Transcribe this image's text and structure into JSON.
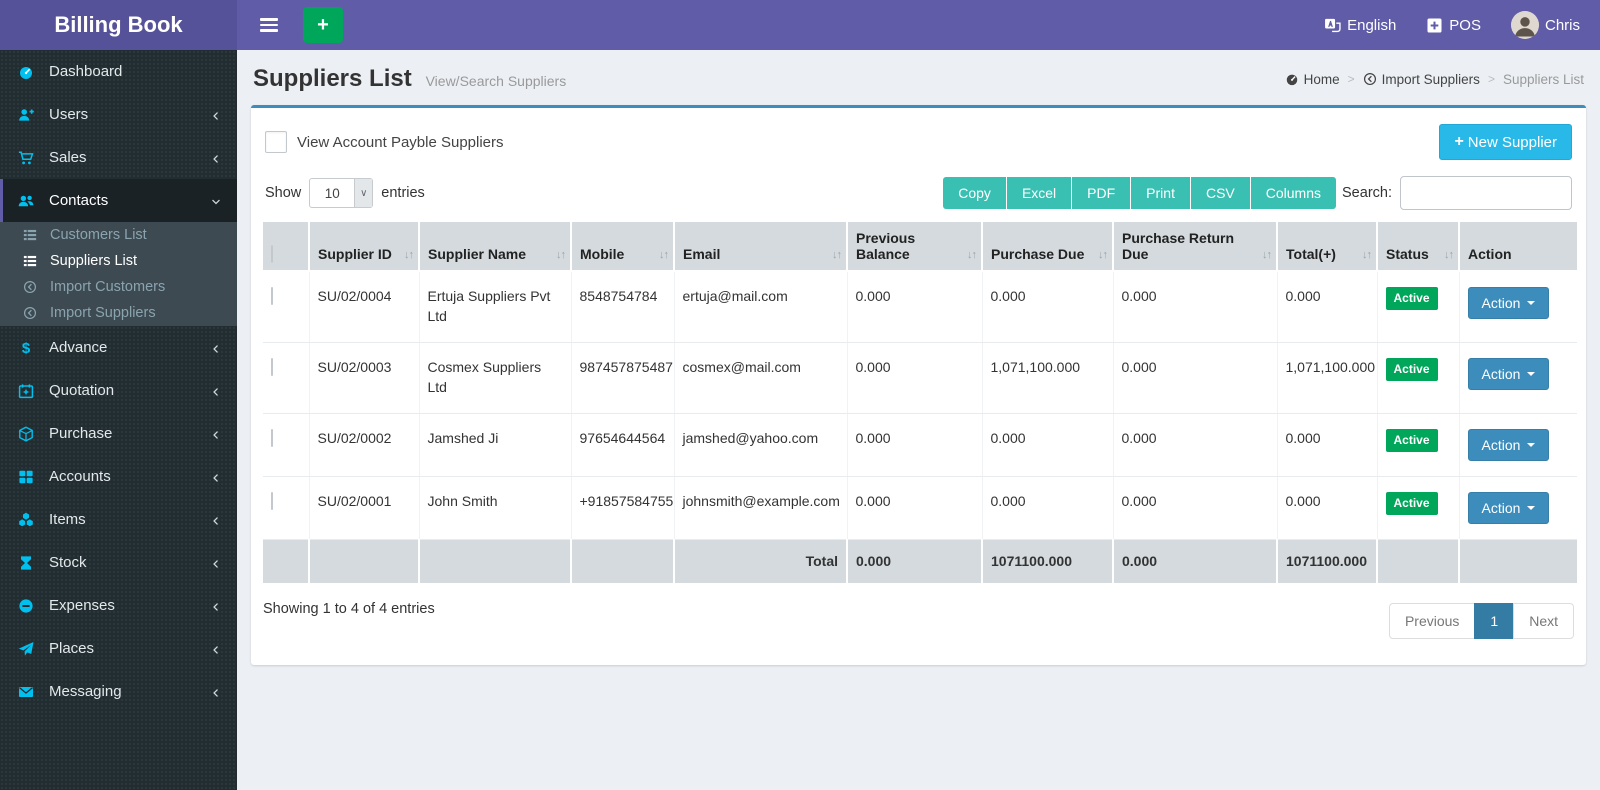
{
  "colors": {
    "navbar": "#605ca8",
    "logo": "#555299",
    "sidebar": "#222d32",
    "submenu": "#3e4a52",
    "sidebar_icon": "#00c0ef",
    "green": "#00a65a",
    "export_teal": "#3ac0b2",
    "new_supplier_blue": "#29b9e8",
    "action_blue": "#3c8dbc",
    "table_header": "#d4dadd",
    "content_bg": "#ecf0f5",
    "badge_green": "#00a65a",
    "pagination_active": "#357ca5"
  },
  "brand": {
    "title": "Billing Book"
  },
  "topbar": {
    "language_label": "English",
    "pos_label": "POS",
    "user_name": "Chris"
  },
  "sidebar": {
    "items": [
      {
        "label": "Dashboard",
        "icon": "tachometer-icon",
        "chevron": null,
        "active": false
      },
      {
        "label": "Users",
        "icon": "user-plus-icon",
        "chevron": "left",
        "active": false
      },
      {
        "label": "Sales",
        "icon": "cart-icon",
        "chevron": "left",
        "active": false
      },
      {
        "label": "Contacts",
        "icon": "users-icon",
        "chevron": "down",
        "active": true,
        "children": [
          {
            "label": "Customers List",
            "icon": "list-icon",
            "active": false
          },
          {
            "label": "Suppliers List",
            "icon": "list-icon",
            "active": true
          },
          {
            "label": "Import Customers",
            "icon": "import-icon",
            "active": false
          },
          {
            "label": "Import Suppliers",
            "icon": "import-icon",
            "active": false
          }
        ]
      },
      {
        "label": "Advance",
        "icon": "dollar-icon",
        "chevron": "left",
        "active": false
      },
      {
        "label": "Quotation",
        "icon": "calendar-plus-icon",
        "chevron": "left",
        "active": false
      },
      {
        "label": "Purchase",
        "icon": "cube-icon",
        "chevron": "left",
        "active": false
      },
      {
        "label": "Accounts",
        "icon": "grid-icon",
        "chevron": "left",
        "active": false
      },
      {
        "label": "Items",
        "icon": "cubes-icon",
        "chevron": "left",
        "active": false
      },
      {
        "label": "Stock",
        "icon": "hourglass-icon",
        "chevron": "left",
        "active": false
      },
      {
        "label": "Expenses",
        "icon": "minus-circle-icon",
        "chevron": "left",
        "active": false
      },
      {
        "label": "Places",
        "icon": "paper-plane-icon",
        "chevron": "left",
        "active": false
      },
      {
        "label": "Messaging",
        "icon": "envelope-icon",
        "chevron": "left",
        "active": false
      }
    ]
  },
  "page": {
    "title": "Suppliers List",
    "subtitle": "View/Search Suppliers",
    "breadcrumb": [
      {
        "label": "Home",
        "icon": "tachometer-icon",
        "current": false
      },
      {
        "label": "Import Suppliers",
        "icon": "import-icon",
        "current": false
      },
      {
        "label": "Suppliers List",
        "icon": null,
        "current": true
      }
    ]
  },
  "card": {
    "filter_label": "View Account Payble Suppliers",
    "filter_checked": false,
    "new_supplier_label": "New Supplier",
    "show_label": "Show",
    "entries_label": "entries",
    "page_length": "10",
    "export_buttons": [
      "Copy",
      "Excel",
      "PDF",
      "Print",
      "CSV",
      "Columns"
    ],
    "search_label": "Search:",
    "search_value": "",
    "table": {
      "columns": [
        {
          "label": "Supplier ID",
          "sortable": true
        },
        {
          "label": "Supplier Name",
          "sortable": true
        },
        {
          "label": "Mobile",
          "sortable": true
        },
        {
          "label": "Email",
          "sortable": true
        },
        {
          "label": "Previous Balance",
          "sortable": true
        },
        {
          "label": "Purchase Due",
          "sortable": true
        },
        {
          "label": "Purchase Return Due",
          "sortable": true
        },
        {
          "label": "Total(+)",
          "sortable": true
        },
        {
          "label": "Status",
          "sortable": true
        },
        {
          "label": "Action",
          "sortable": false
        }
      ],
      "rows": [
        {
          "supplier_id": "SU/02/0004",
          "name": "Ertuja Suppliers Pvt Ltd",
          "mobile": "8548754784",
          "email": "ertuja@mail.com",
          "previous_balance": "0.000",
          "purchase_due": "0.000",
          "purchase_return_due": "0.000",
          "total": "0.000",
          "status": "Active",
          "action_label": "Action"
        },
        {
          "supplier_id": "SU/02/0003",
          "name": "Cosmex Suppliers Ltd",
          "mobile": "987457875487",
          "email": "cosmex@mail.com",
          "previous_balance": "0.000",
          "purchase_due": "1,071,100.000",
          "purchase_return_due": "0.000",
          "total": "1,071,100.000",
          "status": "Active",
          "action_label": "Action"
        },
        {
          "supplier_id": "SU/02/0002",
          "name": "Jamshed Ji",
          "mobile": "97654644564",
          "email": "jamshed@yahoo.com",
          "previous_balance": "0.000",
          "purchase_due": "0.000",
          "purchase_return_due": "0.000",
          "total": "0.000",
          "status": "Active",
          "action_label": "Action"
        },
        {
          "supplier_id": "SU/02/0001",
          "name": "John Smith",
          "mobile": "+91857584755",
          "email": "johnsmith@example.com",
          "previous_balance": "0.000",
          "purchase_due": "0.000",
          "purchase_return_due": "0.000",
          "total": "0.000",
          "status": "Active",
          "action_label": "Action"
        }
      ],
      "total_row": {
        "label": "Total",
        "previous_balance": "0.000",
        "purchase_due": "1071100.000",
        "purchase_return_due": "0.000",
        "total": "1071100.000"
      }
    },
    "footer": {
      "showing_text": "Showing 1 to 4 of 4 entries",
      "pagination": [
        "Previous",
        "1",
        "Next"
      ],
      "active_page": "1"
    }
  }
}
